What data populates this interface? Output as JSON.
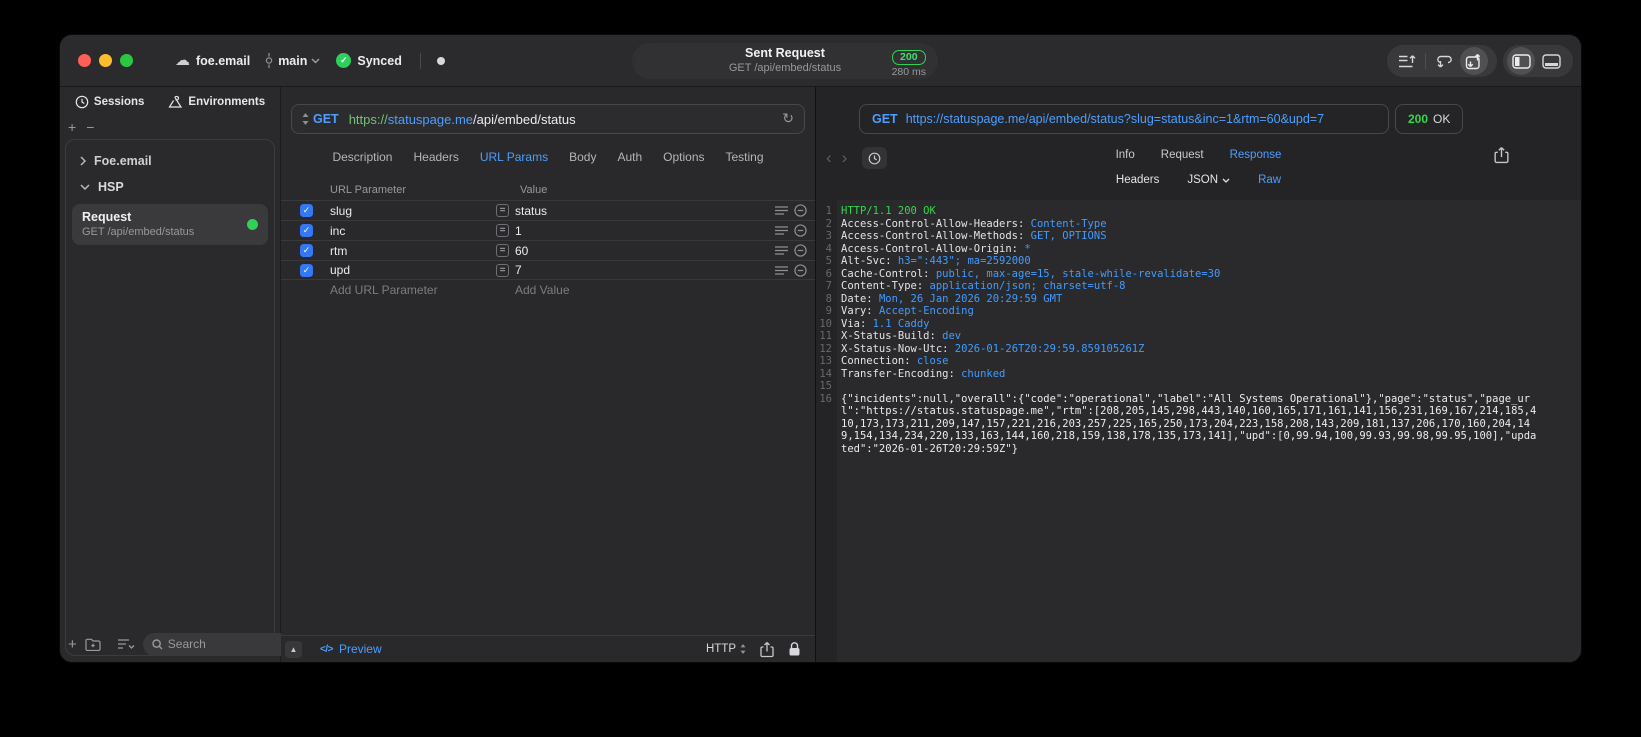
{
  "titlebar": {
    "project_name": "foe.email",
    "branch_name": "main",
    "sync_label": "Synced",
    "request_summary": {
      "title": "Sent Request",
      "subtitle": "GET /api/embed/status",
      "status_code": "200",
      "duration": "280 ms"
    }
  },
  "sidebar": {
    "tabs": [
      {
        "label": "Sessions"
      },
      {
        "label": "Environments"
      }
    ],
    "groups": [
      {
        "label": "Foe.email",
        "expanded": false
      },
      {
        "label": "HSP",
        "expanded": true
      }
    ],
    "request_item": {
      "title": "Request",
      "subtitle": "GET /api/embed/status"
    },
    "search": {
      "placeholder": "Search"
    }
  },
  "request_editor": {
    "method": "GET",
    "url": {
      "scheme": "https://",
      "host": "statuspage.me",
      "path": "/api/embed/status"
    },
    "tabs": [
      {
        "label": "Description"
      },
      {
        "label": "Headers"
      },
      {
        "label": "URL Params"
      },
      {
        "label": "Body"
      },
      {
        "label": "Auth"
      },
      {
        "label": "Options"
      },
      {
        "label": "Testing"
      }
    ],
    "active_tab": "URL Params",
    "params_table": {
      "columns": {
        "name": "URL Parameter",
        "value": "Value"
      },
      "rows": [
        {
          "name": "slug",
          "value": "status",
          "enabled": true
        },
        {
          "name": "inc",
          "value": "1",
          "enabled": true
        },
        {
          "name": "rtm",
          "value": "60",
          "enabled": true
        },
        {
          "name": "upd",
          "value": "7",
          "enabled": true
        }
      ],
      "add_parameter_placeholder": "Add URL Parameter",
      "add_value_placeholder": "Add Value"
    },
    "footer": {
      "preview_label": "Preview",
      "code_glyph": "</>",
      "protocol_label": "HTTP"
    }
  },
  "response_viewer": {
    "request_line": {
      "method": "GET",
      "url": "https://statuspage.me/api/embed/status?slug=status&inc=1&rtm=60&upd=7"
    },
    "status": {
      "code": "200",
      "text": "OK"
    },
    "tabs": [
      {
        "label": "Info"
      },
      {
        "label": "Request"
      },
      {
        "label": "Response"
      }
    ],
    "active_tab": "Response",
    "subtabs": [
      {
        "label": "Headers"
      },
      {
        "label": "JSON"
      },
      {
        "label": "Raw"
      }
    ],
    "active_subtab": "Raw",
    "response": {
      "status_line": "HTTP/1.1 200 OK",
      "headers": [
        {
          "name": "Access-Control-Allow-Headers",
          "value": "Content-Type"
        },
        {
          "name": "Access-Control-Allow-Methods",
          "value": "GET, OPTIONS"
        },
        {
          "name": "Access-Control-Allow-Origin",
          "value": "*"
        },
        {
          "name": "Alt-Svc",
          "value": "h3=\":443\"; ma=2592000"
        },
        {
          "name": "Cache-Control",
          "value": "public, max-age=15, stale-while-revalidate=30"
        },
        {
          "name": "Content-Type",
          "value": "application/json; charset=utf-8"
        },
        {
          "name": "Date",
          "value": "Mon, 26 Jan 2026 20:29:59 GMT"
        },
        {
          "name": "Vary",
          "value": "Accept-Encoding"
        },
        {
          "name": "Via",
          "value": "1.1 Caddy"
        },
        {
          "name": "X-Status-Build",
          "value": "dev"
        },
        {
          "name": "X-Status-Now-Utc",
          "value": "2026-01-26T20:29:59.859105261Z"
        },
        {
          "name": "Connection",
          "value": "close"
        },
        {
          "name": "Transfer-Encoding",
          "value": "chunked"
        }
      ],
      "body": "{\"incidents\":null,\"overall\":{\"code\":\"operational\",\"label\":\"All Systems Operational\"},\"page\":\"status\",\"page_url\":\"https://status.statuspage.me\",\"rtm\":[208,205,145,298,443,140,160,165,171,161,141,156,231,169,167,214,185,410,173,173,211,209,147,157,221,216,203,257,225,165,250,173,204,223,158,208,143,209,181,137,206,170,160,204,149,154,134,234,220,133,163,144,160,218,159,138,178,135,173,141],\"upd\":[0,99.94,100,99.93,99.98,99.95,100],\"updated\":\"2026-01-26T20:29:59Z\"}"
    }
  },
  "colors": {
    "accent_blue": "#4c9fff",
    "success_green": "#32d74b",
    "url_scheme_green": "#72c472",
    "checkbox_blue": "#3478f6"
  }
}
